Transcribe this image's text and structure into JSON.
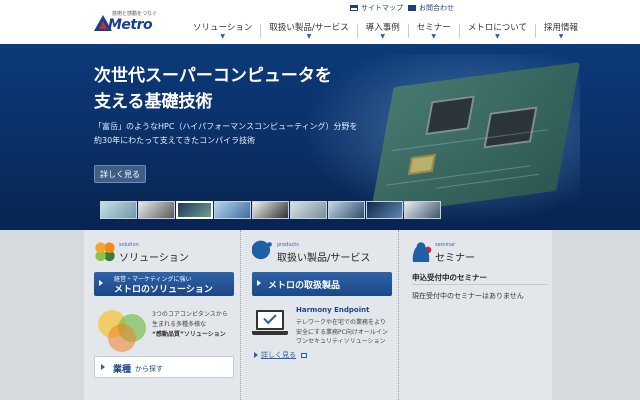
{
  "header": {
    "logo_tagline": "技術と感動をつなぐ",
    "logo_name": "Metro",
    "util_sitemap": "サイトマップ",
    "util_contact": "お問合わせ",
    "nav": [
      {
        "label": "ソリューション"
      },
      {
        "label": "取扱い製品/サービス"
      },
      {
        "label": "導入事例"
      },
      {
        "label": "セミナー"
      },
      {
        "label": "メトロについて"
      },
      {
        "label": "採用情報"
      }
    ]
  },
  "hero": {
    "title_line1": "次世代スーパーコンピュータを",
    "title_line2": "支える基礎技術",
    "desc_line1": "「富岳」のようなHPC（ハイパフォーマンスコンピューティング）分野を",
    "desc_line2": "約30年にわたって支えてきたコンパイラ技術",
    "button": "詳しく見る",
    "thumb_count": 9,
    "active_thumb": 3
  },
  "solution": {
    "en": "solution",
    "ja": "ソリューション",
    "btn_small": "経営・マーケティングに強い",
    "btn_big": "メトロのソリューション",
    "text_line1": "3つのコアコンピタンスから",
    "text_line2": "生まれる多種多様な",
    "text_line3": "“感動品質”ソリューション",
    "industry_big": "業種",
    "industry_small": "から探す"
  },
  "products": {
    "en": "products",
    "ja": "取扱い製品/サービス",
    "btn": "メトロの取扱製品",
    "hb_title": "Harmony Endpoint",
    "hb_line1": "テレワークや在宅での業務をより",
    "hb_line2": "安全にする業務PC向けオールイン",
    "hb_line3": "ワンセキュリティソリューション",
    "more": "詳しく見る"
  },
  "seminar": {
    "en": "seminar",
    "ja": "セミナー",
    "sub": "申込受付中のセミナー",
    "text": "現在受付中のセミナーはありません"
  },
  "colors": {
    "brand": "#1b3f8f",
    "accent_red": "#d9262c",
    "hero_bg": "#0c3a7a",
    "button_blue": "#2f63a7"
  }
}
